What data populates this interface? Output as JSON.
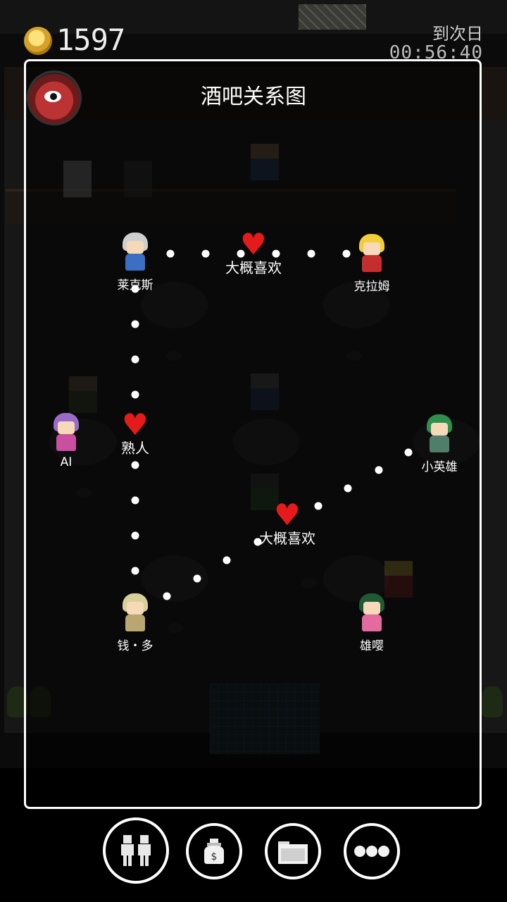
{
  "hud": {
    "coins": "1597",
    "next_day_label": "到次日",
    "timer": "00:56:40"
  },
  "panel": {
    "title": "酒吧关系图"
  },
  "characters": [
    {
      "name": "莱克斯",
      "hair": "#cfcfcf",
      "body": "#3a6fc4"
    },
    {
      "name": "克拉姆",
      "hair": "#f2cf3a",
      "body": "#c62e2e"
    },
    {
      "name": "AI",
      "hair": "#9b6cc7",
      "body": "#c94fa0"
    },
    {
      "name": "小英雄",
      "hair": "#2f8f4e",
      "body": "#4f7f6a"
    },
    {
      "name": "钱・多",
      "hair": "#d9cf9a",
      "body": "#b9a670"
    },
    {
      "name": "雄嘤",
      "hair": "#1f5a35",
      "body": "#e46aa0"
    }
  ],
  "relations": [
    {
      "label": "大概喜欢"
    },
    {
      "label": "熟人"
    },
    {
      "label": "大概喜欢"
    }
  ],
  "menu": [
    {
      "icon": "people-icon",
      "label": "关系"
    },
    {
      "icon": "money-bag-icon",
      "label": "金钱"
    },
    {
      "icon": "folder-icon",
      "label": "文件"
    },
    {
      "icon": "more-icon",
      "label": "更多"
    }
  ],
  "colors": {
    "heart": "#e51b1b",
    "panel_border": "#ffffff",
    "coin": "#e8b830"
  }
}
